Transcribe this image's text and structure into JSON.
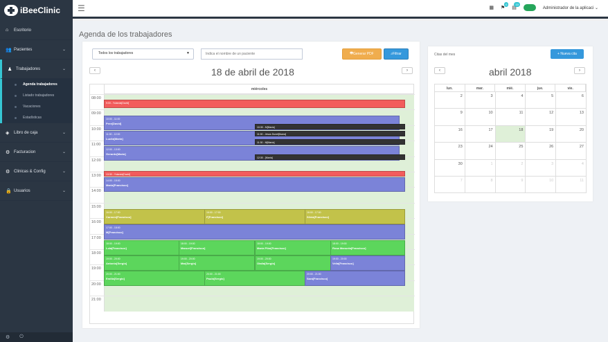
{
  "app": {
    "brand": "iBeeClinic"
  },
  "sidebar": {
    "items": [
      {
        "label": "Escritorio",
        "icon": "home-icon",
        "chev": ""
      },
      {
        "label": "Pacientes",
        "icon": "users-icon",
        "chev": "⌄"
      },
      {
        "label": "Trabajadores",
        "icon": "user-icon",
        "chev": "⌄"
      },
      {
        "label": "Libro de caja",
        "icon": "tag-icon",
        "chev": "⌄"
      },
      {
        "label": "Facturacion",
        "icon": "cogs-icon",
        "chev": "⌄"
      },
      {
        "label": "Clinicas & Config",
        "icon": "gear-icon",
        "chev": "⌄"
      },
      {
        "label": "Usuarios",
        "icon": "lock-icon",
        "chev": "⌄"
      }
    ],
    "sub": [
      "Agenda trabajadores",
      "Listado trabajadores",
      "Vacaciones",
      "Estadísticas"
    ]
  },
  "topbar": {
    "user": "Administrador de la aplicaci",
    "badge1": "0",
    "badge2": "10"
  },
  "page": {
    "title": "Agenda de los trabajadores"
  },
  "filters": {
    "select": "Todos los trabajadores",
    "search_placeholder": "Indica el nombre de un paciente",
    "pdf": "Generar PDF",
    "filter": "Filtrar"
  },
  "day": {
    "title": "18 de abril de 2018",
    "weekday": "miércoles",
    "hours": [
      "08:00",
      "09:00",
      "10:00",
      "11:00",
      "12:00",
      "13:00",
      "14:00",
      "15:00",
      "16:00",
      "17:00",
      "18:00",
      "19:00",
      "20:00",
      "21:00"
    ]
  },
  "events": [
    {
      "time": "9:00 - Yolanda[David]",
      "name": "",
      "color": "#f25c5c"
    },
    {
      "time": "10:00 - 11:00",
      "name": "Pere[David]",
      "color": "#7b83d8"
    },
    {
      "time": "11:00 - 12:00",
      "name": "Lucila[María]",
      "color": "#7b83d8"
    },
    {
      "time": "12:00 - 13:00",
      "name": "Gerardo[María]",
      "color": "#7b83d8"
    },
    {
      "time": "10:30 - M[María]",
      "name": "",
      "color": "#333"
    },
    {
      "time": "11:00 - Jesus Dunet[Ibarra]",
      "name": "",
      "color": "#333"
    },
    {
      "time": "11:30 - M[María]",
      "name": "",
      "color": "#333"
    },
    {
      "time": "12:30 - [María]",
      "name": "",
      "color": "#333"
    },
    {
      "time": "13:30 - Yolanda[David]",
      "name": "",
      "color": "#f25c5c"
    },
    {
      "time": "14:00 - 15:00",
      "name": "Maria[Francisco]",
      "color": "#7b83d8"
    },
    {
      "time": "16:00 - 17:00",
      "name": "Carmen[Francisco]",
      "color": "#c2c24a"
    },
    {
      "time": "16:00 - 17:00",
      "name": "F[Francisco]",
      "color": "#c2c24a"
    },
    {
      "time": "16:00 - 17:00",
      "name": "Silvia[Francisco]",
      "color": "#c2c24a"
    },
    {
      "time": "17:00 - 18:00",
      "name": "M[Francisco]",
      "color": "#7b83d8"
    },
    {
      "time": "18:00 - 19:00",
      "name": "Lola[Francisco]",
      "color": "#5cd65c"
    },
    {
      "time": "18:00 - 19:00",
      "name": "Manuel[Francisco]",
      "color": "#5cd65c"
    },
    {
      "time": "18:00 - 19:00",
      "name": "María Pilar[Francisco]",
      "color": "#5cd65c"
    },
    {
      "time": "18:00 - 19:00",
      "name": "Rosa Manuela[Francisco]",
      "color": "#5cd65c"
    },
    {
      "time": "19:00 - 20:00",
      "name": "Antonio[Sergio]",
      "color": "#5cd65c"
    },
    {
      "time": "19:00 - 20:00",
      "name": "Mar[Sergio]",
      "color": "#5cd65c"
    },
    {
      "time": "19:00 - 20:00",
      "name": "Otalia[Sergio]",
      "color": "#5cd65c"
    },
    {
      "time": "19:00 - 20:00",
      "name": "Velia[Francisco]",
      "color": "#7b83d8"
    },
    {
      "time": "20:00 - 21:00",
      "name": "Emilia[Sergio]",
      "color": "#5cd65c"
    },
    {
      "time": "20:00 - 21:00",
      "name": "Paula[Sergio]",
      "color": "#5cd65c"
    },
    {
      "time": "20:00 - 21:00",
      "name": "Sara[Francisco]",
      "color": "#7b83d8"
    }
  ],
  "calendar": {
    "heading": "Citas del mes",
    "new_btn": "+ Nueva cita",
    "title": "abril 2018",
    "days": [
      "lun.",
      "mar.",
      "mié.",
      "jue.",
      "vie."
    ],
    "weeks": [
      [
        "",
        "2",
        "3",
        "4",
        "5",
        "6"
      ],
      [
        "",
        "9",
        "10",
        "11",
        "12",
        "13"
      ],
      [
        "",
        "16",
        "17",
        "18",
        "19",
        "20"
      ],
      [
        "",
        "23",
        "24",
        "25",
        "26",
        "27"
      ],
      [
        "",
        "30",
        "1",
        "2",
        "3",
        "4"
      ],
      [
        "",
        "7",
        "8",
        "9",
        "10",
        "11"
      ]
    ]
  }
}
